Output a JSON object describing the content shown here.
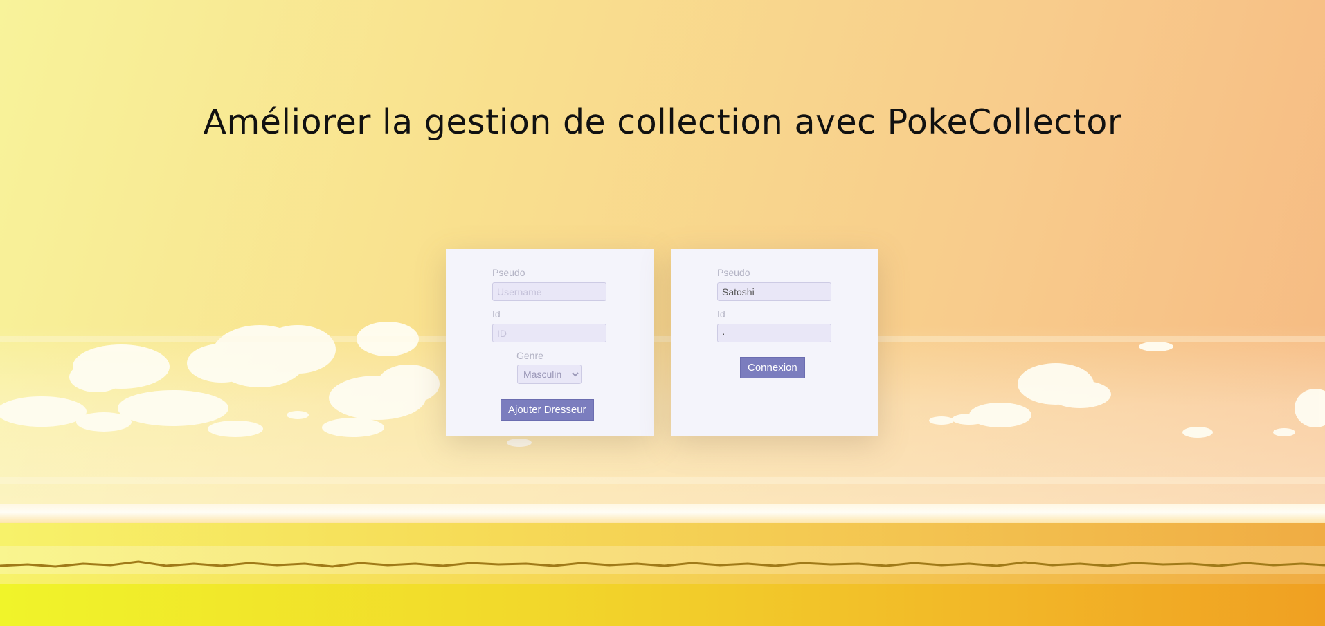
{
  "page": {
    "title": "Améliorer la gestion de collection avec PokeCollector"
  },
  "register_form": {
    "pseudo_label": "Pseudo",
    "pseudo_placeholder": "Username",
    "pseudo_value": "",
    "id_label": "Id",
    "id_placeholder": "ID",
    "id_value": "",
    "genre_label": "Genre",
    "genre_selected": "Masculin",
    "submit_label": "Ajouter Dresseur"
  },
  "login_form": {
    "pseudo_label": "Pseudo",
    "pseudo_value": "Satoshi",
    "id_label": "Id",
    "id_value": "·",
    "submit_label": "Connexion"
  },
  "colors": {
    "button": "#7b7dbe",
    "card": "#f4f4fb",
    "input": "#e9e7f7",
    "label": "#b3b3c4"
  }
}
